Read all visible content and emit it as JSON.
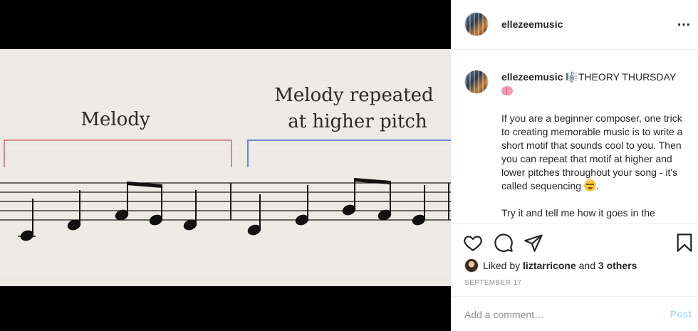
{
  "media": {
    "labels": {
      "melody": "Melody",
      "repeated_line1": "Melody repeated",
      "repeated_line2": "at higher pitch"
    },
    "colors": {
      "bracket_red": "#d9888e",
      "bracket_blue": "#6c86d6",
      "notes": "#111111"
    }
  },
  "header": {
    "username": "ellezeemusic",
    "more_icon": "more-options-icon"
  },
  "caption": {
    "username": "ellezeemusic",
    "title": "THEORY THURSDAY",
    "paragraph1": "If you are a beginner composer, one trick to creating memorable music is to write a short motif that sounds cool to you. Then you can repeat that motif at higher and lower pitches throughout your song - it's called sequencing",
    "paragraph2": "Try it and tell me how it goes in the",
    "emojis": [
      "musical-score-emoji",
      "brain-emoji",
      "exploding-head-emoji"
    ]
  },
  "actions": {
    "icons": [
      "heart-icon",
      "comment-icon",
      "share-icon",
      "bookmark-icon"
    ],
    "liked_prefix": "Liked by",
    "liked_user": "liztarricone",
    "liked_and": "and",
    "liked_others": "3 others",
    "date": "SEPTEMBER 17"
  },
  "comment": {
    "placeholder": "Add a comment…",
    "post_label": "Post",
    "post_color": "#b3dbff"
  }
}
